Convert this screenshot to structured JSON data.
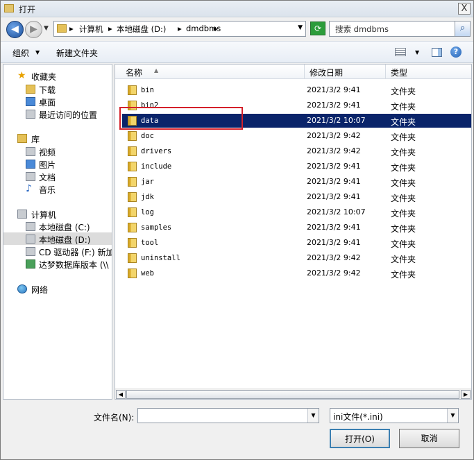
{
  "window": {
    "title": "打开",
    "close_glyph": "X"
  },
  "address": {
    "crumbs": [
      "计算机",
      "本地磁盘 (D:)",
      "dmdbms"
    ],
    "separator": "▸",
    "search_placeholder": "搜索 dmdbms"
  },
  "toolbar": {
    "organize": "组织",
    "new_folder": "新建文件夹"
  },
  "nav": {
    "favorites": "收藏夹",
    "downloads": "下载",
    "desktop": "桌面",
    "recent": "最近访问的位置",
    "libraries": "库",
    "videos": "视频",
    "pictures": "图片",
    "documents": "文档",
    "music": "音乐",
    "computer": "计算机",
    "drive_c": "本地磁盘 (C:)",
    "drive_d": "本地磁盘 (D:)",
    "drive_f": "CD 驱动器 (F:) 新加",
    "dameng": "达梦数据库版本 (\\\\",
    "network": "网络"
  },
  "columns": {
    "name": "名称",
    "date": "修改日期",
    "type": "类型"
  },
  "files": [
    {
      "name": "bin",
      "date": "2021/3/2 9:41",
      "type": "文件夹"
    },
    {
      "name": "bin2",
      "date": "2021/3/2 9:41",
      "type": "文件夹"
    },
    {
      "name": "data",
      "date": "2021/3/2 10:07",
      "type": "文件夹"
    },
    {
      "name": "doc",
      "date": "2021/3/2 9:42",
      "type": "文件夹"
    },
    {
      "name": "drivers",
      "date": "2021/3/2 9:42",
      "type": "文件夹"
    },
    {
      "name": "include",
      "date": "2021/3/2 9:41",
      "type": "文件夹"
    },
    {
      "name": "jar",
      "date": "2021/3/2 9:41",
      "type": "文件夹"
    },
    {
      "name": "jdk",
      "date": "2021/3/2 9:41",
      "type": "文件夹"
    },
    {
      "name": "log",
      "date": "2021/3/2 10:07",
      "type": "文件夹"
    },
    {
      "name": "samples",
      "date": "2021/3/2 9:41",
      "type": "文件夹"
    },
    {
      "name": "tool",
      "date": "2021/3/2 9:41",
      "type": "文件夹"
    },
    {
      "name": "uninstall",
      "date": "2021/3/2 9:42",
      "type": "文件夹"
    },
    {
      "name": "web",
      "date": "2021/3/2 9:42",
      "type": "文件夹"
    }
  ],
  "selected_file": "data",
  "bottom": {
    "filename_label": "文件名(N):",
    "filename_value": "",
    "filter": "ini文件(*.ini)",
    "open": "打开(O)",
    "cancel": "取消"
  },
  "colors": {
    "selection": "#0a246a",
    "highlight_box": "#d4202a"
  }
}
